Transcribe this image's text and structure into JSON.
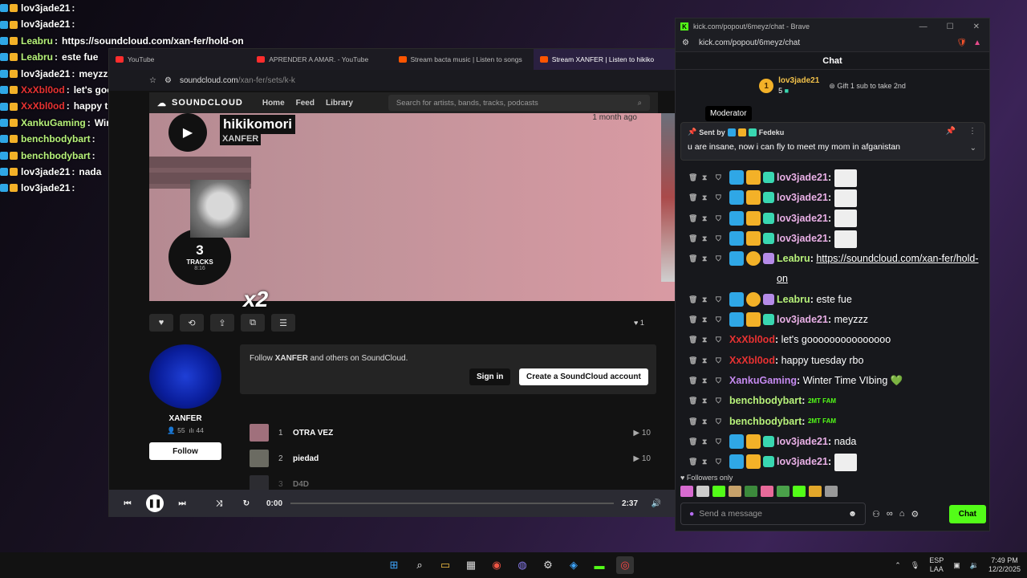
{
  "overlay_chat": [
    {
      "name": "lov3jade21",
      "msg": "",
      "color": "#ffffff"
    },
    {
      "name": "lov3jade21",
      "msg": "",
      "color": "#ffffff"
    },
    {
      "name": "Leabru",
      "msg": "https://soundcloud.com/xan-fer/hold-on",
      "color": "#b7f27a"
    },
    {
      "name": "Leabru",
      "msg": "este fue",
      "color": "#b7f27a"
    },
    {
      "name": "lov3jade21",
      "msg": "meyzzz",
      "color": "#ffffff"
    },
    {
      "name": "XxXbl0od",
      "msg": "let's gooooooooooooooo",
      "color": "#e83232"
    },
    {
      "name": "XxXbl0od",
      "msg": "happy tuesday rbo",
      "color": "#e83232"
    },
    {
      "name": "XankuGaming",
      "msg": "Winter Time VIbing",
      "color": "#b7f27a"
    },
    {
      "name": "benchbodybart",
      "msg": "",
      "color": "#b7f27a"
    },
    {
      "name": "benchbodybart",
      "msg": "",
      "color": "#b7f27a"
    },
    {
      "name": "lov3jade21",
      "msg": "nada",
      "color": "#ffffff"
    },
    {
      "name": "lov3jade21",
      "msg": "",
      "color": "#ffffff"
    }
  ],
  "browser": {
    "tabs": [
      {
        "label": "YouTube",
        "color": "#ff2d2d"
      },
      {
        "label": "APRENDER A AMAR. - YouTube",
        "color": "#ff2d2d"
      },
      {
        "label": "Stream bacta music | Listen to songs",
        "color": "#ff5500"
      },
      {
        "label": "Stream XANFER | Listen to hikiko",
        "color": "#ff5500"
      }
    ],
    "url_domain": "soundcloud.com",
    "url_path": "/xan-fer/sets/k-k"
  },
  "soundcloud": {
    "logo_text": "SOUNDCLOUD",
    "nav": [
      "Home",
      "Feed",
      "Library"
    ],
    "search_placeholder": "Search for artists, bands, tracks, podcasts",
    "playlist_title": "hikikomori",
    "artist": "XANFER",
    "posted": "1 month ago",
    "tracks_count": "3",
    "tracks_label": "TRACKS",
    "duration": "8:16",
    "overlay_text": "x2",
    "likes": "1",
    "user_name": "XANFER",
    "followers": "55",
    "following": "44",
    "follow_label": "Follow",
    "promo_text_before": "Follow ",
    "promo_text_bold": "XANFER",
    "promo_text_after": " and others on SoundCloud.",
    "signin_label": "Sign in",
    "create_label": "Create a SoundCloud account",
    "tracks": [
      {
        "num": "1",
        "title": "OTRA VEZ",
        "plays": "10",
        "thumb": "#a0707c"
      },
      {
        "num": "2",
        "title": "piedad",
        "plays": "10",
        "thumb": "#6b6b62"
      },
      {
        "num": "3",
        "title": "D4D",
        "plays": "",
        "thumb": "#555560"
      }
    ],
    "player": {
      "elapsed": "0:00",
      "total": "2:37",
      "progress": 0
    }
  },
  "kick": {
    "window_title": "kick.com/popout/6meyz/chat - Brave",
    "url": "kick.com/popout/6meyz/chat",
    "header": "Chat",
    "top_gifter": "lov3jade21",
    "top_gifter_count": "5",
    "top_gifter_rank": "1",
    "gift_text": "Gift 1 sub to take 2nd",
    "tooltip": "Moderator",
    "pinned_sent_by": "Sent by",
    "pinned_user": "Fedeku",
    "pinned_text": "u are insane, now i can fly to meet my mom in afganistan",
    "messages": [
      {
        "user": "lov3jade21",
        "color": "#e9b0e6",
        "text": "",
        "badges": [
          "mod",
          "crown",
          "gift"
        ],
        "emote": true
      },
      {
        "user": "lov3jade21",
        "color": "#e9b0e6",
        "text": "",
        "badges": [
          "mod",
          "crown",
          "gift"
        ],
        "emote": true
      },
      {
        "user": "lov3jade21",
        "color": "#e9b0e6",
        "text": "",
        "badges": [
          "mod",
          "crown",
          "gift"
        ],
        "emote": true
      },
      {
        "user": "lov3jade21",
        "color": "#e9b0e6",
        "text": "",
        "badges": [
          "mod",
          "crown",
          "gift"
        ],
        "emote": true
      },
      {
        "user": "Leabru",
        "color": "#b7f27a",
        "text": "https://soundcloud.com/xan-fer/hold-on",
        "badges": [
          "mod",
          "coin",
          "giftp"
        ],
        "link": true
      },
      {
        "user": "Leabru",
        "color": "#b7f27a",
        "text": "este fue",
        "badges": [
          "mod",
          "coin",
          "giftp"
        ]
      },
      {
        "user": "lov3jade21",
        "color": "#e9b0e6",
        "text": "meyzzz",
        "badges": [
          "mod",
          "crown",
          "gift"
        ]
      },
      {
        "user": "XxXbl0od",
        "color": "#e83232",
        "text": "let's gooooooooooooooo",
        "badges": []
      },
      {
        "user": "XxXbl0od",
        "color": "#e83232",
        "text": "happy tuesday rbo",
        "badges": []
      },
      {
        "user": "XankuGaming",
        "color": "#c58af0",
        "text": "Winter Time VIbing 💚",
        "badges": []
      },
      {
        "user": "benchbodybart",
        "color": "#b7f27a",
        "text": "",
        "badges": [],
        "fam": "2MT FAM"
      },
      {
        "user": "benchbodybart",
        "color": "#b7f27a",
        "text": "",
        "badges": [],
        "fam": "2MT FAM"
      },
      {
        "user": "lov3jade21",
        "color": "#e9b0e6",
        "text": "nada",
        "badges": [
          "mod",
          "crown",
          "gift"
        ]
      },
      {
        "user": "lov3jade21",
        "color": "#e9b0e6",
        "text": "",
        "badges": [
          "mod",
          "crown",
          "gift"
        ],
        "emote": true
      }
    ],
    "followers_only": "Followers only",
    "input_placeholder": "Send a message",
    "send_label": "Chat",
    "accent": "#53fc18"
  },
  "taskbar": {
    "lang": "ESP",
    "lang_sub": "LAA",
    "time": "7:49 PM",
    "date": "12/2/2025"
  }
}
